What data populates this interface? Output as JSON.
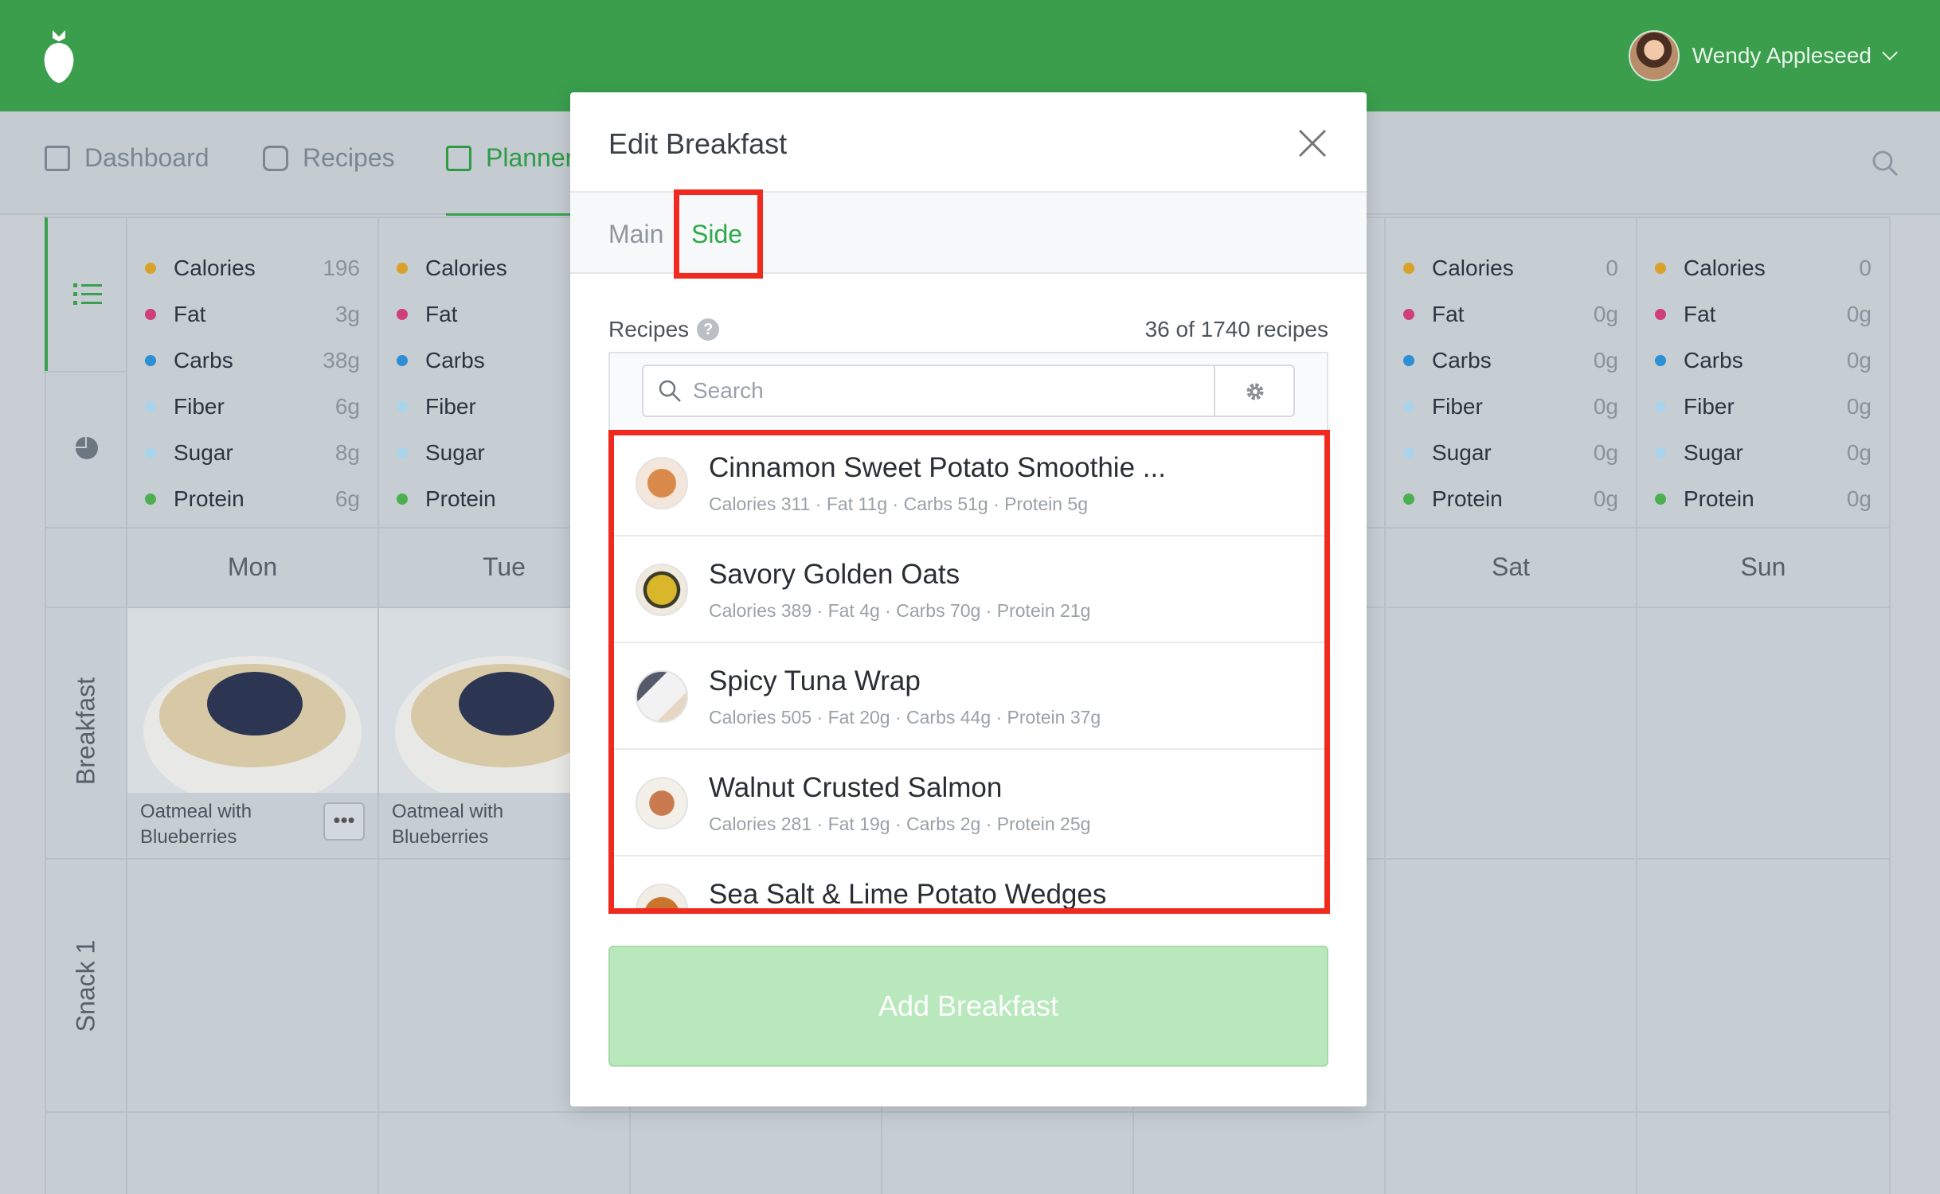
{
  "header": {
    "user_name": "Wendy Appleseed"
  },
  "nav": {
    "items": [
      {
        "label": "Dashboard"
      },
      {
        "label": "Recipes"
      },
      {
        "label": "Planner"
      }
    ]
  },
  "nutrients": {
    "labels": [
      "Calories",
      "Fat",
      "Carbs",
      "Fiber",
      "Sugar",
      "Protein"
    ],
    "colors": [
      "#d9a22a",
      "#cf3f78",
      "#2d8fd5",
      "#a9d4ec",
      "#a9d4ec",
      "#4caf50"
    ],
    "mon_values": [
      "196",
      "3g",
      "38g",
      "6g",
      "8g",
      "6g"
    ],
    "sat_values": [
      "0",
      "0g",
      "0g",
      "0g",
      "0g",
      "0g"
    ],
    "sun_values": [
      "0",
      "0g",
      "0g",
      "0g",
      "0g",
      "0g"
    ]
  },
  "days": {
    "mon": "Mon",
    "tue": "Tue",
    "sat": "Sat",
    "sun": "Sun"
  },
  "meals": {
    "breakfast": "Breakfast",
    "snack1": "Snack 1"
  },
  "planner_items": {
    "mon_breakfast": "Oatmeal with Blueberries",
    "tue_breakfast": "Oatmeal with Blueberries",
    "more_button": "•••"
  },
  "modal": {
    "title": "Edit Breakfast",
    "tabs": {
      "main": "Main",
      "side": "Side"
    },
    "active_tab": "Side",
    "recipes_label": "Recipes",
    "help_icon": "?",
    "recipes_count": "36 of 1740 recipes",
    "search_placeholder": "Search",
    "recipes": [
      {
        "name": "Cinnamon Sweet Potato Smoothie ...",
        "meta": "Calories 311 · Fat 11g · Carbs 51g · Protein 5g"
      },
      {
        "name": "Savory Golden Oats",
        "meta": "Calories 389 · Fat 4g · Carbs 70g · Protein 21g"
      },
      {
        "name": "Spicy Tuna Wrap",
        "meta": "Calories 505 · Fat 20g · Carbs 44g · Protein 37g"
      },
      {
        "name": "Walnut Crusted Salmon",
        "meta": "Calories 281 · Fat 19g · Carbs 2g · Protein 25g"
      },
      {
        "name": "Sea Salt & Lime Potato Wedges",
        "meta": ""
      }
    ],
    "add_button": "Add Breakfast"
  },
  "colors": {
    "brand_green": "#3a9e4d",
    "active_green": "#2eaa4a",
    "highlight_red": "#f02a1e",
    "add_button_disabled": "#b8e8bb"
  }
}
